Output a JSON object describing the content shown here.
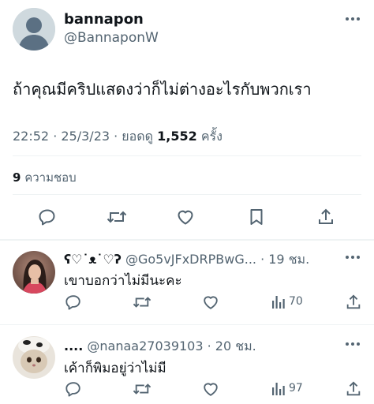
{
  "main_tweet": {
    "display_name": "bannapon",
    "handle": "@BannaponW",
    "text": "ถ้าคุณมีคริปแสดงว่าก็ไม่ต่างอะไรกับพวกเรา",
    "meta_time": "22:52 · 25/3/23 · ยอดดู ",
    "views_count": "1,552",
    "views_suffix": " ครั้ง",
    "likes_count": "9",
    "likes_label": " ความชอบ"
  },
  "replies": [
    {
      "display_name": "ʕ♡˙ᴥ˙♡ʔ",
      "handle_time": "@Go5vJFxDRPBwG... · 19 ชม.",
      "text": "เขาบอกว่าไม่มีนะคะ",
      "views": "70"
    },
    {
      "display_name": "....",
      "handle_time": "@nanaa27039103 · 20 ชม.",
      "text": "เค้าก็พิมอยู่ว่าไม่มี",
      "views": "97"
    }
  ],
  "colors": {
    "text": "#0f1419",
    "muted": "#536471",
    "divider": "#eff3f4",
    "avatar_default": "#cfd9de"
  },
  "icons": [
    "reply-icon",
    "retweet-icon",
    "like-icon",
    "bookmark-icon",
    "share-icon",
    "views-icon",
    "more-icon"
  ]
}
